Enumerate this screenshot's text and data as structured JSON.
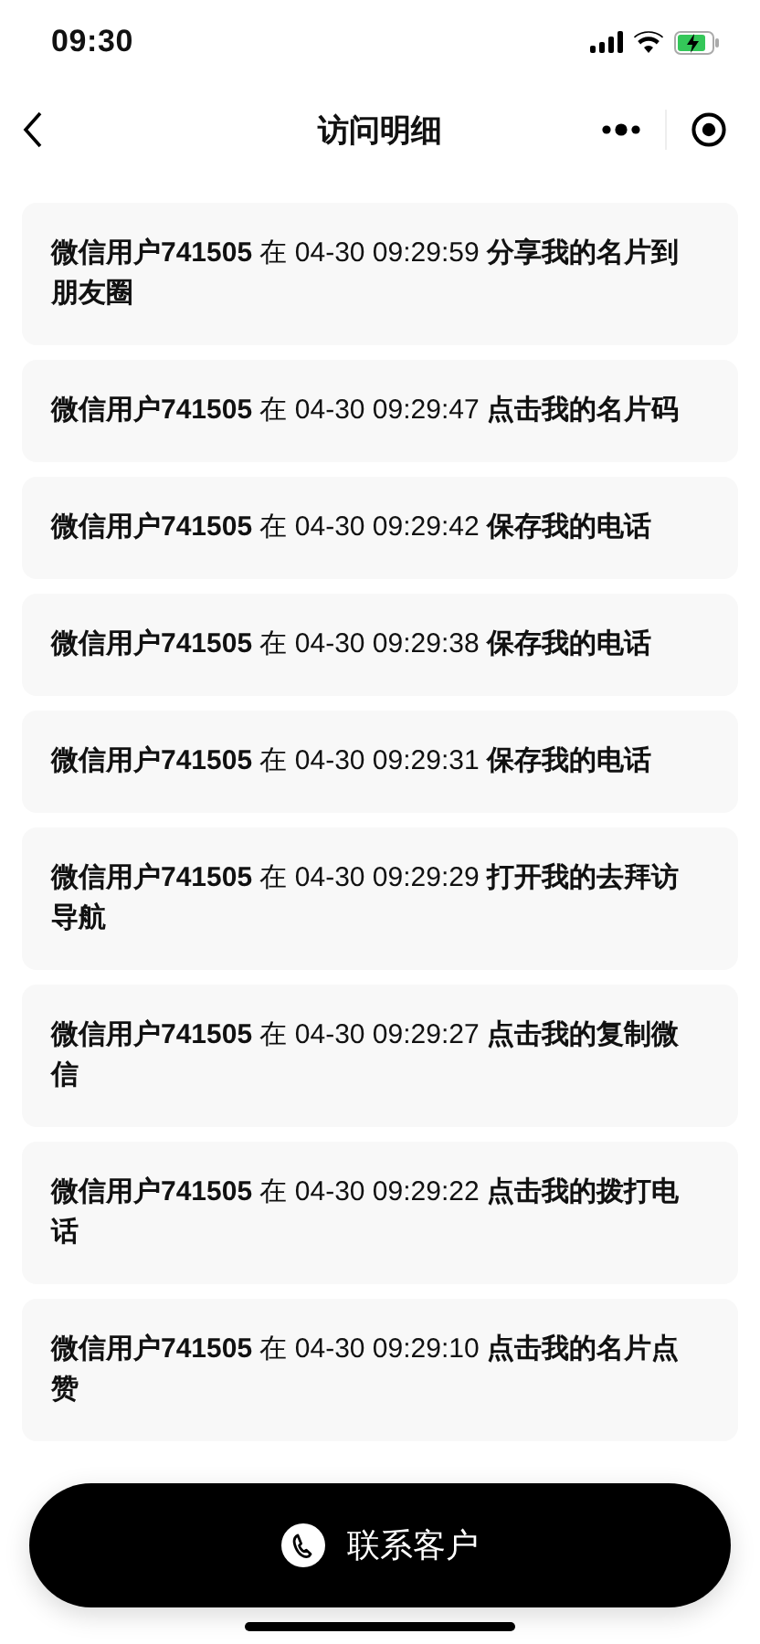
{
  "status_bar": {
    "time": "09:30"
  },
  "nav": {
    "title": "访问明细"
  },
  "records": [
    {
      "text": "**微信用户741505** 在 04-30 09:29:59 **分享我的名片到朋友圈**"
    },
    {
      "text": "**微信用户741505** 在 04-30 09:29:47 **点击我的名片码**"
    },
    {
      "text": "**微信用户741505** 在 04-30 09:29:42 **保存我的电话**"
    },
    {
      "text": "**微信用户741505** 在 04-30 09:29:38 **保存我的电话**"
    },
    {
      "text": "**微信用户741505** 在 04-30 09:29:31 **保存我的电话**"
    },
    {
      "text": "**微信用户741505** 在 04-30 09:29:29 **打开我的去拜访导航**"
    },
    {
      "text": "**微信用户741505** 在 04-30 09:29:27 **点击我的复制微信**"
    },
    {
      "text": "**微信用户741505** 在 04-30 09:29:22 **点击我的拨打电话**"
    },
    {
      "text": "**微信用户741505** 在 04-30 09:29:10 **点击我的名片点赞**"
    }
  ],
  "contact_button": {
    "label": "联系客户"
  }
}
